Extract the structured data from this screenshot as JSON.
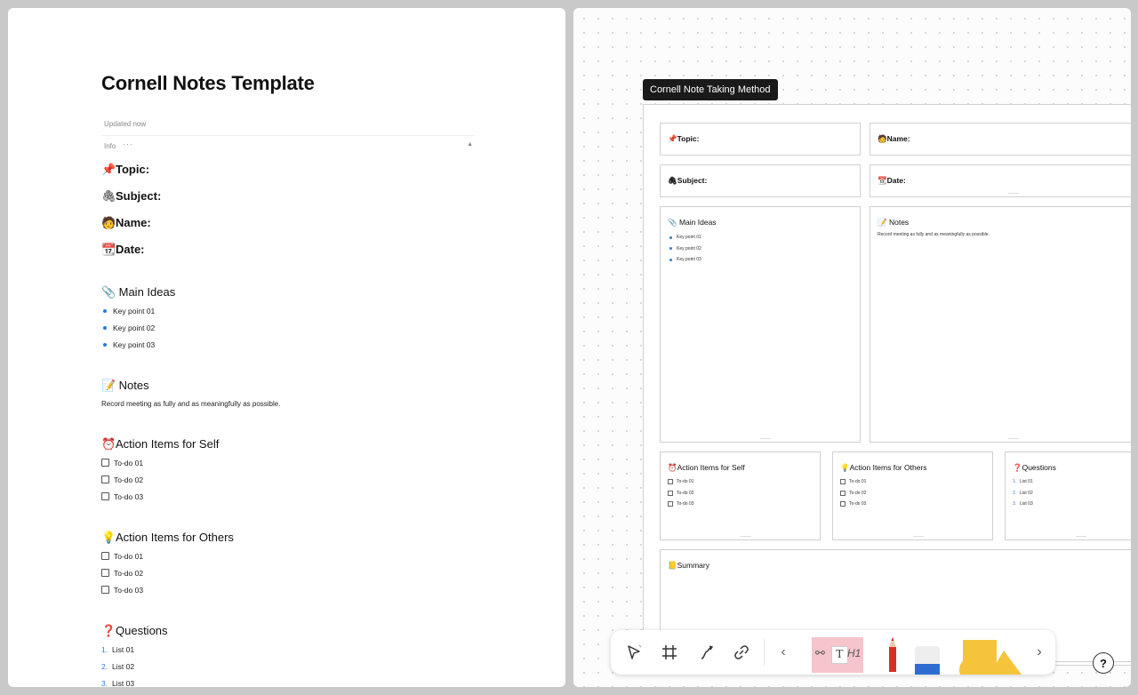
{
  "doc": {
    "title": "Cornell Notes Template",
    "updated": "Updated now",
    "info_label": "Info",
    "info_menu": "···",
    "info_caret": "▲",
    "props": [
      {
        "emoji": "📌",
        "label": "Topic:"
      },
      {
        "emoji": "🖇",
        "label": "Subject:"
      },
      {
        "emoji": "🧑",
        "label": "Name:"
      },
      {
        "emoji": "📆",
        "label": "Date:"
      }
    ],
    "main_ideas": {
      "emoji": "📎",
      "title": "Main Ideas",
      "items": [
        "Key point 01",
        "Key point 02",
        "Key point 03"
      ]
    },
    "notes": {
      "emoji": "📝",
      "title": "Notes",
      "text": "Record meeting as fully and as meaningfully as possible."
    },
    "action_self": {
      "emoji": "⏰",
      "title": "Action Items for Self",
      "items": [
        "To-do 01",
        "To-do 02",
        "To-do 03"
      ]
    },
    "action_others": {
      "emoji": "💡",
      "title": "Action Items for Others",
      "items": [
        "To-do 01",
        "To-do 02",
        "To-do 03"
      ]
    },
    "questions": {
      "emoji": "❓",
      "title": "Questions",
      "numbers": [
        "1.",
        "2.",
        "3."
      ],
      "items": [
        "List 01",
        "List 02",
        "List 03"
      ]
    }
  },
  "board": {
    "title": "Cornell Note Taking Method",
    "topic": {
      "emoji": "📌",
      "label": "Topic:"
    },
    "name": {
      "emoji": "🧑",
      "label": "Name:"
    },
    "subject": {
      "emoji": "🖇",
      "label": "Subject:"
    },
    "date": {
      "emoji": "📆",
      "label": "Date:"
    },
    "main_ideas": {
      "emoji": "📎",
      "title": "Main Ideas",
      "items": [
        "Key point 01",
        "Key point 02",
        "Key point 03"
      ]
    },
    "notes": {
      "emoji": "📝",
      "title": "Notes",
      "text": "Record meeting as fully and as meaningfully as possible."
    },
    "action_self": {
      "emoji": "⏰",
      "title": "Action Items for Self",
      "items": [
        "To-do 01",
        "To-do 02",
        "To-do 03"
      ]
    },
    "action_others": {
      "emoji": "💡",
      "title": "Action Items for Others",
      "items": [
        "To-do 01",
        "To-do 02",
        "To-do 03"
      ]
    },
    "questions": {
      "emoji": "❓",
      "title": "Questions",
      "numbers": [
        "1.",
        "2.",
        "3."
      ],
      "items": [
        "List 01",
        "List 02",
        "List 03"
      ]
    },
    "summary": {
      "emoji": "📒",
      "title": "Summary"
    }
  },
  "toolbar": {
    "tools": [
      "select-tool",
      "frame-tool",
      "connector-tool",
      "link-tool"
    ],
    "prev": "‹",
    "next": "›",
    "text_label": "T",
    "h1_label": "H1",
    "help": "?"
  },
  "colors": {
    "accent": "#2e7bd6",
    "shape_yellow": "#f6c43a",
    "sticky_pink": "#f6c5cc",
    "title_bg": "#1a1a1a"
  }
}
